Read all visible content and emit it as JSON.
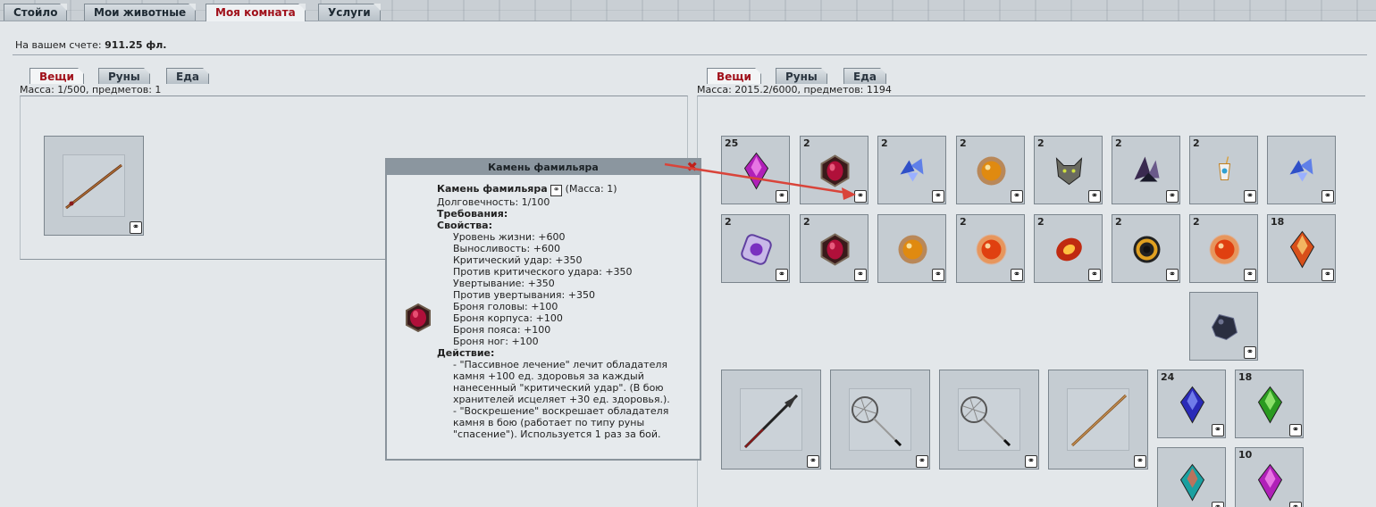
{
  "top_tabs": [
    {
      "label": "Стойло",
      "active": false
    },
    {
      "label": "Мои животные",
      "active": false
    },
    {
      "label": "Моя комната",
      "active": true
    },
    {
      "label": "Услуги",
      "active": false
    }
  ],
  "balance": {
    "label": "На вашем счете:",
    "value": "911.25 фл."
  },
  "left": {
    "tabs": [
      "Вещи",
      "Руны",
      "Еда"
    ],
    "active_tab": "Вещи",
    "mass": "Масса: 1/500, предметов: 1",
    "items": [
      {
        "icon": "staff-icon",
        "count": ""
      }
    ]
  },
  "right": {
    "tabs": [
      "Вещи",
      "Руны",
      "Еда"
    ],
    "active_tab": "Вещи",
    "mass": "Масса: 2015.2/6000, предметов: 1194",
    "row1": [
      {
        "icon": "purple-crystal-icon",
        "count": "25"
      },
      {
        "icon": "ruby-gem-icon",
        "count": "2"
      },
      {
        "icon": "blue-shards-icon",
        "count": "2"
      },
      {
        "icon": "amber-gem-icon",
        "count": "2"
      },
      {
        "icon": "wolf-head-icon",
        "count": "2"
      },
      {
        "icon": "dark-crystal-icon",
        "count": "2"
      },
      {
        "icon": "amulet-icon",
        "count": "2"
      },
      {
        "icon": "blue-shards-icon",
        "count": ""
      }
    ],
    "row2": [
      {
        "icon": "violet-orb-icon",
        "count": "2"
      },
      {
        "icon": "ruby-gem-icon",
        "count": "2"
      },
      {
        "icon": "amber-gem-icon",
        "count": ""
      },
      {
        "icon": "fire-orb-icon",
        "count": "2"
      },
      {
        "icon": "flame-gem-icon",
        "count": "2"
      },
      {
        "icon": "gold-ring-icon",
        "count": "2"
      },
      {
        "icon": "fire-orb-icon",
        "count": "2"
      },
      {
        "icon": "fire-crystal-icon",
        "count": "18"
      }
    ],
    "row3": [
      {
        "icon": "dark-stone-icon",
        "count": ""
      }
    ],
    "row4_big": [
      {
        "icon": "spear-icon"
      },
      {
        "icon": "net-icon"
      },
      {
        "icon": "net-icon"
      },
      {
        "icon": "wooden-staff-icon"
      }
    ],
    "row4_small": [
      {
        "icon": "blue-crystal-icon",
        "count": "24"
      },
      {
        "icon": "green-crystal-icon",
        "count": "18"
      }
    ],
    "row5_small": [
      {
        "icon": "rainbow-crystal-icon",
        "count": ""
      },
      {
        "icon": "purple-crystal-icon",
        "count": "10"
      }
    ]
  },
  "tooltip": {
    "title": "Камень фамильяра",
    "name": "Камень фамильяра",
    "mass": "(Масса: 1)",
    "durability": "Долговечность: 1/100",
    "requirements": "Требования:",
    "props_title": "Свойства:",
    "props": [
      "Уровень жизни: +600",
      "Выносливость: +600",
      "Критический удар: +350",
      "Против критического удара: +350",
      "Увертывание: +350",
      "Против увертывания: +350",
      "Броня головы: +100",
      "Броня корпуса: +100",
      "Броня пояса: +100",
      "Броня ног: +100"
    ],
    "action_title": "Действие:",
    "action_lines": [
      "- \"Пассивное лечение\" лечит обладателя",
      "камня +100 ед. здоровья за каждый",
      "нанесенный \"критический удар\". (В бою",
      "хранителей исцеляет +30 ед. здоровья.).",
      "- \"Воскрешение\" воскрешает обладателя",
      "камня в бою (работает по типу руны",
      "\"спасение\"). Используется 1 раз за бой."
    ],
    "close": "✖"
  },
  "colors": {
    "active_tab_text": "#a0101a",
    "arrow": "#d9443a"
  }
}
